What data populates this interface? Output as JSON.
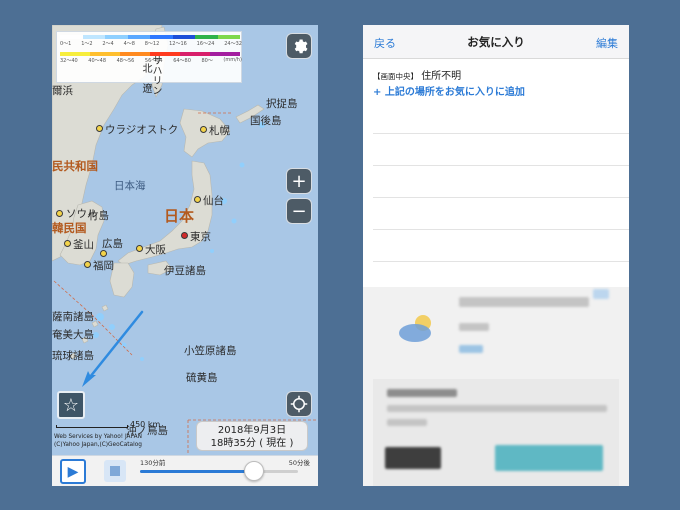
{
  "left_screen": {
    "legend": {
      "colors": [
        "#ffffff",
        "#bfe6ff",
        "#8fd0ff",
        "#5aa8ff",
        "#2f78ff",
        "#1d4fd8",
        "#2fb34a",
        "#7ed84b",
        "#f7ee3c",
        "#ffbf2e",
        "#ff8a1f",
        "#ff3b1f",
        "#d81f6b",
        "#a31ea0"
      ],
      "row1": [
        "0～1",
        "1～2",
        "2～4",
        "4～8",
        "8～12",
        "12～16",
        "16～24",
        "24～32"
      ],
      "row2": [
        "32～40",
        "40～48",
        "48～56",
        "56～64",
        "64～80",
        "80～",
        "(mm/h)"
      ]
    },
    "labels": {
      "vladivostok": "ウラジオストク",
      "sapporo": "札幌",
      "etorofu": "択捉島",
      "kunashiri": "国後島",
      "korea_north_part": "民共和国",
      "sea_of_japan": "日本海",
      "sendai": "仙台",
      "japan": "日本",
      "seoul": "ソウル",
      "korea_south_part": "韓民国",
      "takeshima": "竹島",
      "busan": "釜山",
      "hiroshima": "広島",
      "osaka": "大阪",
      "tokyo": "東京",
      "fukuoka": "福岡",
      "izu_islands": "伊豆諸島",
      "satsunan": "薩南諸島",
      "amami": "奄美大島",
      "ryukyu": "琉球諸島",
      "ogasawara": "小笠原諸島",
      "iwojima": "硫黄島",
      "okinotorishima": "沖ノ鳥島",
      "sakhalin": "サハリン",
      "jilin_part": "爾浜",
      "edge_a": "北",
      "edge_b": "遼"
    },
    "scale_label": "450 km",
    "copyright_1": "Web Services by Yahoo! JAPAN",
    "copyright_2": "(C)Yahoo Japan,(C)GeoCatalog",
    "date_line": "2018年9月3日",
    "time_line": "18時35分 ( 現在 )",
    "slider_left_label": "130分前",
    "slider_right_label": "50分後",
    "slider_fraction": 0.72,
    "icons": {
      "settings": "gear-icon",
      "zoom_in": "plus-icon",
      "zoom_out": "minus-icon",
      "favorite": "star-icon",
      "location": "crosshair-icon",
      "play": "play-icon",
      "stop": "stop-icon"
    },
    "symbols": {
      "zoom_in": "+",
      "zoom_out": "−",
      "star": "☆",
      "play": "▶"
    }
  },
  "right_screen": {
    "nav": {
      "back": "戻る",
      "title": "お気に入り",
      "edit": "編集"
    },
    "location_tag": "【画面中央】",
    "location_value": "住所不明",
    "add_favorite": "+ 上記の場所をお気に入りに追加"
  }
}
